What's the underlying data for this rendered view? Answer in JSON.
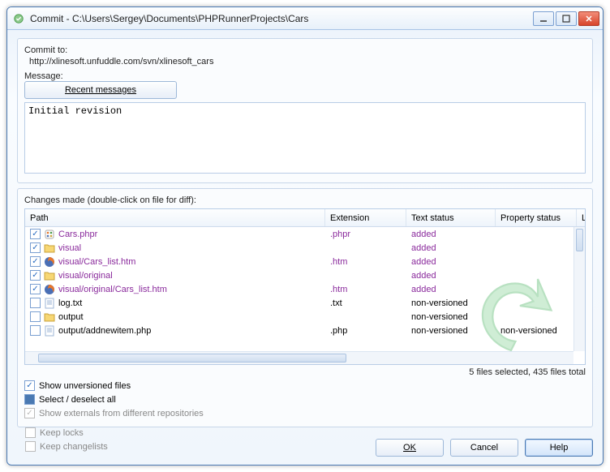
{
  "titlebar": {
    "title": "Commit - C:\\Users\\Sergey\\Documents\\PHPRunnerProjects\\Cars"
  },
  "commit_to": {
    "label": "Commit to:",
    "url": "http://xlinesoft.unfuddle.com/svn/xlinesoft_cars"
  },
  "message": {
    "label": "Message:",
    "recent_button": "Recent messages",
    "value": "Initial revision"
  },
  "changes": {
    "label": "Changes made (double-click on file for diff):",
    "columns": {
      "path": "Path",
      "ext": "Extension",
      "text_status": "Text status",
      "prop_status": "Property status",
      "lock": "Lo"
    },
    "rows": [
      {
        "checked": true,
        "icon": "phprunner",
        "path": "Cars.phpr",
        "ext": ".phpr",
        "text_status": "added",
        "prop_status": "",
        "color": "purple"
      },
      {
        "checked": true,
        "icon": "folder",
        "path": "visual",
        "ext": "",
        "text_status": "added",
        "prop_status": "",
        "color": "purple"
      },
      {
        "checked": true,
        "icon": "firefox",
        "path": "visual/Cars_list.htm",
        "ext": ".htm",
        "text_status": "added",
        "prop_status": "",
        "color": "purple"
      },
      {
        "checked": true,
        "icon": "folder",
        "path": "visual/original",
        "ext": "",
        "text_status": "added",
        "prop_status": "",
        "color": "purple"
      },
      {
        "checked": true,
        "icon": "firefox",
        "path": "visual/original/Cars_list.htm",
        "ext": ".htm",
        "text_status": "added",
        "prop_status": "",
        "color": "purple"
      },
      {
        "checked": false,
        "icon": "text",
        "path": "log.txt",
        "ext": ".txt",
        "text_status": "non-versioned",
        "prop_status": "",
        "color": ""
      },
      {
        "checked": false,
        "icon": "folder",
        "path": "output",
        "ext": "",
        "text_status": "non-versioned",
        "prop_status": "",
        "color": ""
      },
      {
        "checked": false,
        "icon": "text",
        "path": "output/addnewitem.php",
        "ext": ".php",
        "text_status": "non-versioned",
        "prop_status": "non-versioned",
        "color": ""
      }
    ],
    "summary": "5 files selected, 435 files total"
  },
  "options": {
    "show_unversioned": {
      "label": "Show unversioned files",
      "checked": true,
      "disabled": false
    },
    "select_all": {
      "label": "Select / deselect all",
      "state": "tri",
      "disabled": false
    },
    "show_externals": {
      "label": "Show externals from different repositories",
      "checked": true,
      "disabled": true
    },
    "keep_locks": {
      "label": "Keep locks",
      "checked": false,
      "disabled": true
    },
    "keep_changelists": {
      "label": "Keep changelists",
      "checked": false,
      "disabled": true
    }
  },
  "buttons": {
    "ok": "OK",
    "cancel": "Cancel",
    "help": "Help"
  },
  "icons": {
    "app": "↻",
    "folder": "📁",
    "firefox": "🦊",
    "text": "📄",
    "phprunner": "🧩"
  }
}
